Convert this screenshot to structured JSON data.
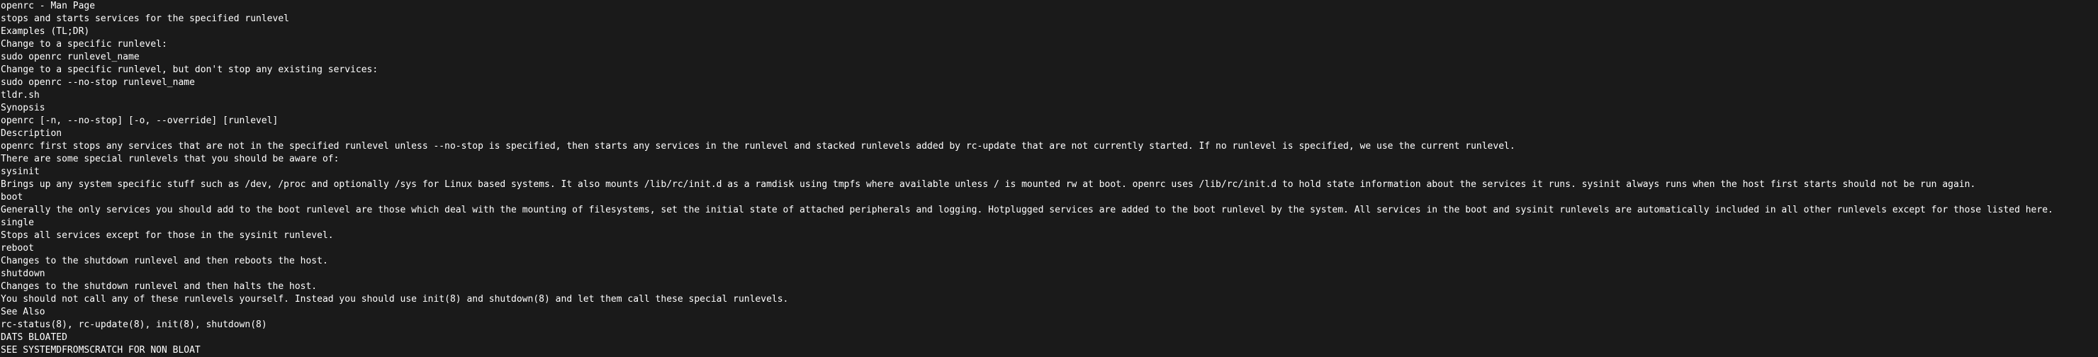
{
  "colors": {
    "background": "#1a1a1a",
    "text": "#ffffff"
  },
  "lines": [
    "openrc - Man Page",
    "stops and starts services for the specified runlevel",
    "Examples (TL;DR)",
    "Change to a specific runlevel:",
    "sudo openrc runlevel_name",
    "Change to a specific runlevel, but don't stop any existing services:",
    "sudo openrc --no-stop runlevel_name",
    "tldr.sh",
    "Synopsis",
    "openrc [-n, --no-stop] [-o, --override] [runlevel]",
    "Description",
    "openrc first stops any services that are not in the specified runlevel unless --no-stop is specified, then starts any services in the runlevel and stacked runlevels added by rc-update that are not currently started. If no runlevel is specified, we use the current runlevel.",
    "There are some special runlevels that you should be aware of:",
    "sysinit",
    "Brings up any system specific stuff such as /dev, /proc and optionally /sys for Linux based systems. It also mounts /lib/rc/init.d as a ramdisk using tmpfs where available unless / is mounted rw at boot. openrc uses /lib/rc/init.d to hold state information about the services it runs. sysinit always runs when the host first starts should not be run again.",
    "boot",
    "Generally the only services you should add to the boot runlevel are those which deal with the mounting of filesystems, set the initial state of attached peripherals and logging. Hotplugged services are added to the boot runlevel by the system. All services in the boot and sysinit runlevels are automatically included in all other runlevels except for those listed here.",
    "single",
    "Stops all services except for those in the sysinit runlevel.",
    "reboot",
    "Changes to the shutdown runlevel and then reboots the host.",
    "shutdown",
    "Changes to the shutdown runlevel and then halts the host.",
    "You should not call any of these runlevels yourself. Instead you should use init(8) and shutdown(8) and let them call these special runlevels.",
    "See Also",
    "rc-status(8), rc-update(8), init(8), shutdown(8)",
    "DATS BLOATED",
    "SEE SYSTEMDFROMSCRATCH FOR NON BLOAT"
  ]
}
